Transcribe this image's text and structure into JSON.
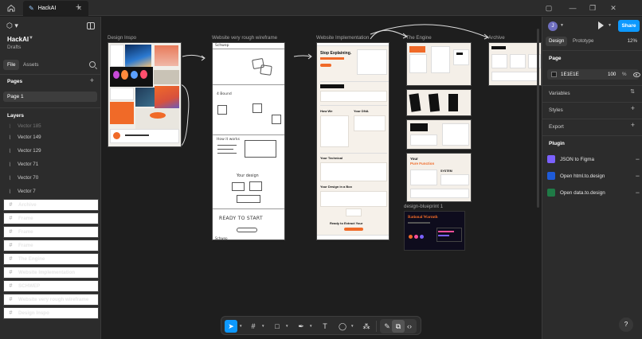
{
  "tab": {
    "title": "HackAI"
  },
  "project": {
    "name": "HackAI",
    "team": "Drafts"
  },
  "left_tabs": [
    "File",
    "Assets"
  ],
  "pages": {
    "heading": "Pages",
    "items": [
      "Page 1"
    ]
  },
  "layers": {
    "heading": "Layers",
    "items": [
      {
        "name": "Vector 149",
        "type": "vector"
      },
      {
        "name": "Vector 129",
        "type": "vector"
      },
      {
        "name": "Vector 71",
        "type": "vector"
      },
      {
        "name": "Vector 70",
        "type": "vector"
      },
      {
        "name": "Vector 7",
        "type": "vector"
      },
      {
        "name": "Archive",
        "type": "frame"
      },
      {
        "name": "Frame",
        "type": "frame"
      },
      {
        "name": "Frame",
        "type": "frame"
      },
      {
        "name": "Frame",
        "type": "frame"
      },
      {
        "name": "The Engine",
        "type": "frame"
      },
      {
        "name": "Website Implementation",
        "type": "frame"
      },
      {
        "name": "SCHWEP",
        "type": "frame"
      },
      {
        "name": "Website very rough wireframe",
        "type": "frame"
      },
      {
        "name": "Design Inspo",
        "type": "frame"
      }
    ]
  },
  "canvas": {
    "frame_labels": {
      "design_inspo": "Design Inspo",
      "wireframe": "Website very rough wireframe",
      "implementation": "Website Implementation",
      "engine": "The Engine",
      "archive": "Archive",
      "blueprint": "design-blueprint 1"
    },
    "wireframe_text": {
      "brand": "Schwep",
      "step_hint": "4 Bound",
      "how": "How it works",
      "your_design": "Your design",
      "ready": "READY TO START",
      "footer": "Schwep"
    },
    "implementation_text": {
      "hero": "Stop Explaining.",
      "section_how": "How We",
      "section_dna": "Your DNA",
      "technical": "Your        Technical",
      "design_box": "Your Design       in a Box",
      "ready": "Ready to Extract Your"
    },
    "engine_text": {
      "title": "Your",
      "subtitle": "Pure Function",
      "system": "SYSTEM"
    },
    "blueprint_text": {
      "title": "Rational Warmth"
    }
  },
  "right_panel": {
    "avatar": "J",
    "share": "Share",
    "tabs": [
      "Design",
      "Prototype"
    ],
    "zoom": "12%",
    "page_section": "Page",
    "page_color": "1E1E1E",
    "page_opacity": "100",
    "page_opacity_unit": "%",
    "sections": [
      "Variables",
      "Styles",
      "Export"
    ],
    "plugin_heading": "Plugin",
    "plugins": [
      {
        "name": "JSON to Figma",
        "color": "#7b61ff"
      },
      {
        "name": "Open html.to.design",
        "color": "#1e5bd8"
      },
      {
        "name": "Open data.to.design",
        "color": "#1f7a46"
      }
    ]
  },
  "help": "?",
  "colors": {
    "accent": "#0d99ff",
    "canvas": "#1e1e1e",
    "panel": "#2c2c2c",
    "orange": "#f06a28"
  }
}
